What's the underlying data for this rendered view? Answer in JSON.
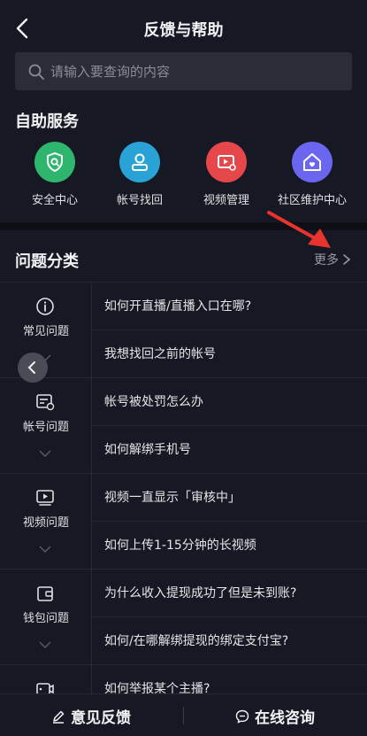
{
  "header": {
    "title": "反馈与帮助"
  },
  "search": {
    "placeholder": "请输入要查询的内容"
  },
  "self_service": {
    "title": "自助服务",
    "items": [
      {
        "label": "安全中心",
        "icon": "shield-icon",
        "color": "#2fb66e"
      },
      {
        "label": "帐号找回",
        "icon": "user-icon",
        "color": "#29a3d6"
      },
      {
        "label": "视频管理",
        "icon": "video-settings-icon",
        "color": "#e5474b"
      },
      {
        "label": "社区维护中心",
        "icon": "home-heart-icon",
        "color": "#6b66f0"
      }
    ]
  },
  "categories": {
    "title": "问题分类",
    "more_label": "更多",
    "groups": [
      {
        "label": "常见问题",
        "icon": "info-icon",
        "questions": [
          "如何开直播/直播入口在哪?",
          "我想找回之前的帐号"
        ]
      },
      {
        "label": "帐号问题",
        "icon": "account-card-icon",
        "questions": [
          "帐号被处罚怎么办",
          "如何解绑手机号"
        ]
      },
      {
        "label": "视频问题",
        "icon": "video-play-icon",
        "questions": [
          "视频一直显示「审核中」",
          "如何上传1-15分钟的长视频"
        ]
      },
      {
        "label": "钱包问题",
        "icon": "wallet-icon",
        "questions": [
          "为什么收入提现成功了但是未到账?",
          "如何/在哪解绑提现的绑定支付宝?"
        ]
      },
      {
        "label": "",
        "icon": "live-camera-icon",
        "questions": [
          "如何举报某个主播?"
        ]
      }
    ]
  },
  "bottom_bar": {
    "feedback_label": "意见反馈",
    "consult_label": "在线咨询"
  }
}
